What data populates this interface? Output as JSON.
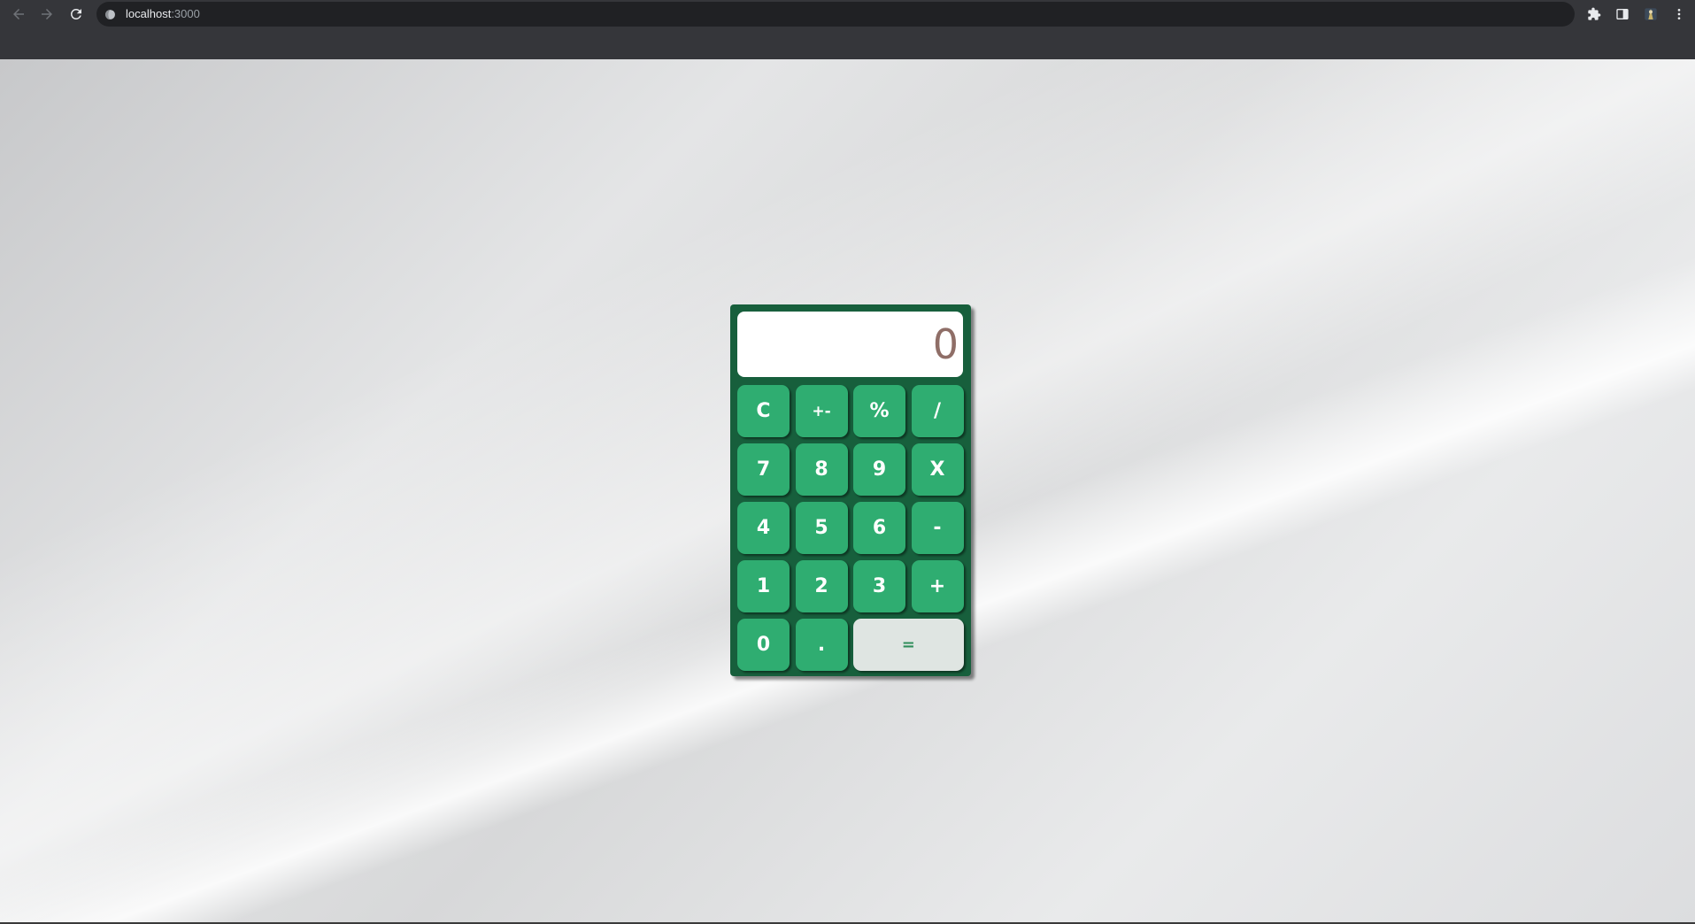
{
  "browser": {
    "url_host": "localhost",
    "url_port": ":3000",
    "icons": {
      "back": "arrow-left-icon",
      "forward": "arrow-right-icon",
      "reload": "reload-icon",
      "site_info": "site-info-icon",
      "extensions": "puzzle-icon",
      "side_panel": "side-panel-icon",
      "profile": "profile-avatar-icon",
      "menu": "kebab-menu-icon"
    }
  },
  "calculator": {
    "display_value": "0",
    "colors": {
      "body": "#175f3c",
      "key": "#2fad71",
      "key_text": "#ffffff",
      "equals_key": "#dfe5e2",
      "equals_text": "#2f8d5a",
      "display_text": "#8f6e67"
    },
    "keys": [
      {
        "label": "C",
        "name": "clear-button"
      },
      {
        "label": "+-",
        "name": "sign-toggle-button"
      },
      {
        "label": "%",
        "name": "percent-button"
      },
      {
        "label": "/",
        "name": "divide-button"
      },
      {
        "label": "7",
        "name": "digit-7-button"
      },
      {
        "label": "8",
        "name": "digit-8-button"
      },
      {
        "label": "9",
        "name": "digit-9-button"
      },
      {
        "label": "X",
        "name": "multiply-button"
      },
      {
        "label": "4",
        "name": "digit-4-button"
      },
      {
        "label": "5",
        "name": "digit-5-button"
      },
      {
        "label": "6",
        "name": "digit-6-button"
      },
      {
        "label": "-",
        "name": "subtract-button"
      },
      {
        "label": "1",
        "name": "digit-1-button"
      },
      {
        "label": "2",
        "name": "digit-2-button"
      },
      {
        "label": "3",
        "name": "digit-3-button"
      },
      {
        "label": "+",
        "name": "add-button"
      },
      {
        "label": "0",
        "name": "digit-0-button"
      },
      {
        "label": ".",
        "name": "decimal-button"
      },
      {
        "label": "=",
        "name": "equals-button"
      }
    ]
  }
}
